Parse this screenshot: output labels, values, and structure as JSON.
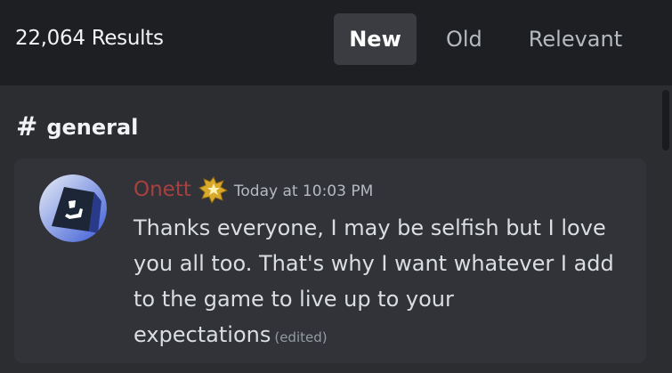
{
  "header": {
    "results_count": "22,064 Results",
    "sort_tabs": [
      {
        "label": "New",
        "selected": true
      },
      {
        "label": "Old",
        "selected": false
      },
      {
        "label": "Relevant",
        "selected": false
      }
    ]
  },
  "channel": {
    "hash": "#",
    "name": "general"
  },
  "message": {
    "author": "Onett",
    "author_color": "#a84040",
    "role_icon": "gold-star-badge-icon",
    "timestamp": "Today at 10:03 PM",
    "text": "Thanks everyone, I may be selfish but I love you all too. That's why I want whatever I add to the game to live up to your expectations",
    "edited_label": "(edited)"
  },
  "colors": {
    "topbar": "#1e1f22",
    "pane": "#2b2d31",
    "card": "#313338",
    "selected_tab": "#3a3c42"
  }
}
